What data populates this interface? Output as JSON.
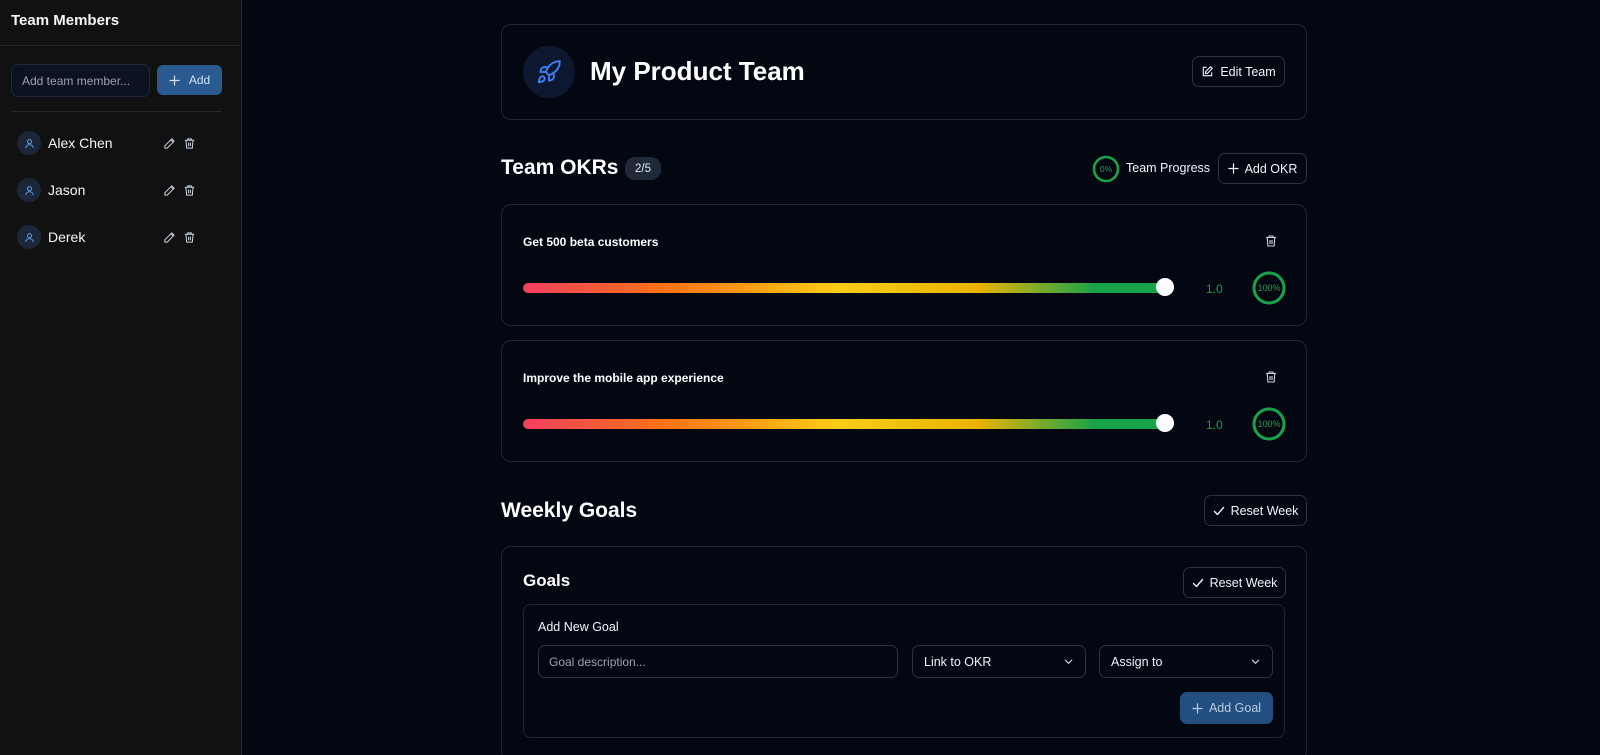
{
  "sidebar": {
    "title": "Team Members",
    "add_placeholder": "Add team member...",
    "add_label": "Add",
    "members": [
      {
        "name": "Alex Chen"
      },
      {
        "name": "Jason"
      },
      {
        "name": "Derek"
      }
    ]
  },
  "team": {
    "name": "My Product Team",
    "edit_label": "Edit Team",
    "icon": "rocket-icon"
  },
  "okrs": {
    "title": "Team OKRs",
    "count": "2/5",
    "progress_value": "0%",
    "progress_label": "Team Progress",
    "add_label": "Add OKR",
    "items": [
      {
        "title": "Get 500 beta customers",
        "value": "1.0",
        "progress": 1.0,
        "percent": "100%"
      },
      {
        "title": "Improve the mobile app experience",
        "value": "1.0",
        "progress": 1.0,
        "percent": "100%"
      }
    ]
  },
  "weekly": {
    "title": "Weekly Goals",
    "reset_label": "Reset Week",
    "goals_title": "Goals",
    "goals_reset_label": "Reset Week",
    "add_goal_title": "Add New Goal",
    "goal_placeholder": "Goal description...",
    "link_okr": "Link to OKR",
    "assign_to": "Assign to",
    "add_goal_label": "Add Goal"
  },
  "colors": {
    "accent_green": "#16a34a",
    "accent_blue": "#3b82f6",
    "background": "#030712"
  }
}
